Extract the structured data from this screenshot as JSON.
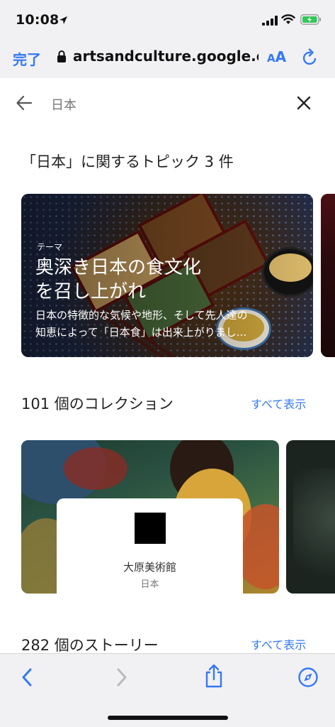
{
  "status_bar": {
    "time": "10:08",
    "icons": [
      "location-arrow-icon",
      "signal-icon",
      "wifi-icon",
      "battery-charging-icon"
    ]
  },
  "browser": {
    "done_label": "完了",
    "url": "artsandculture.google.com",
    "text_size_label_small": "A",
    "text_size_label_large": "A",
    "accent_color": "#3478f6"
  },
  "search": {
    "query": "日本"
  },
  "topics_section": {
    "title": "「日本」に関するトピック 3 件",
    "card": {
      "label": "テーマ",
      "title_line1": "奥深き日本の食文化",
      "title_line2": "を召し上がれ",
      "desc_line1": "日本の特徴的な気候や地形、そして先人達の",
      "desc_line2": "知恵によって「日本食」は出来上がりまし..."
    }
  },
  "collections_section": {
    "title": "101 個のコレクション",
    "see_all": "すべて表示",
    "card": {
      "name": "大原美術館",
      "location": "日本"
    }
  },
  "stories_section": {
    "title": "282 個のストーリー",
    "see_all": "すべて表示"
  },
  "toolbar": {
    "icons": [
      "back-icon",
      "forward-icon",
      "share-icon",
      "compass-icon"
    ]
  }
}
